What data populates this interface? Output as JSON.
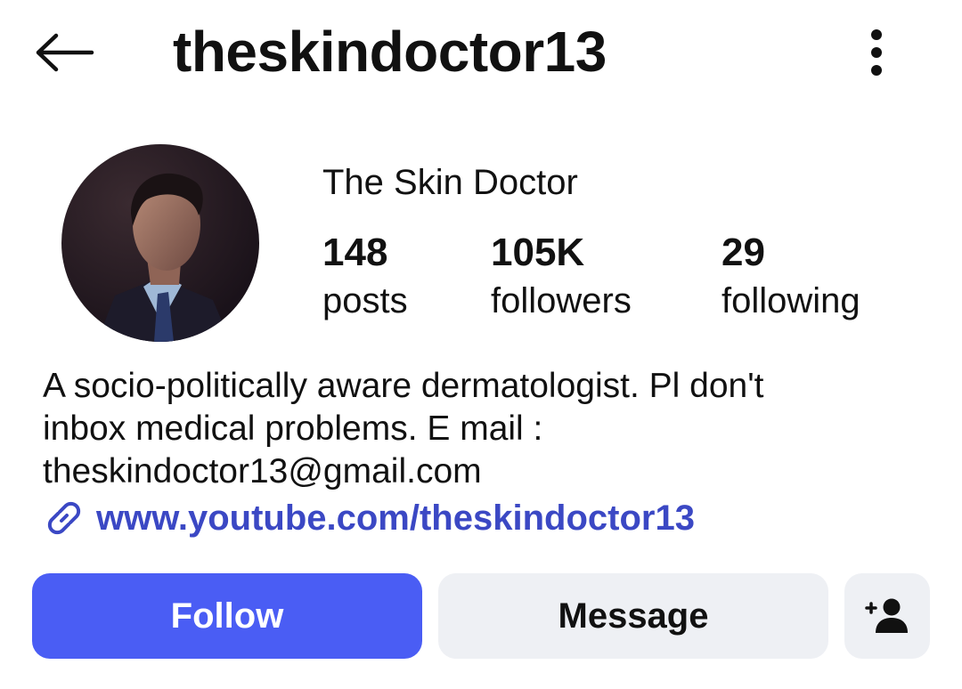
{
  "header": {
    "username": "theskindoctor13",
    "back_icon": "arrow-left-icon",
    "more_icon": "more-vertical-icon"
  },
  "profile": {
    "display_name": "The Skin Doctor",
    "avatar": "avatar",
    "stats": {
      "posts": {
        "count": "148",
        "label": "posts"
      },
      "followers": {
        "count": "105K",
        "label": "followers"
      },
      "following": {
        "count": "29",
        "label": "following"
      }
    },
    "bio_lines": [
      "A socio-politically aware dermatologist. Pl don't",
      "inbox medical problems. E mail :",
      "theskindoctor13@gmail.com"
    ],
    "link": {
      "icon": "link-icon",
      "text": "www.youtube.com/theskindoctor13"
    }
  },
  "actions": {
    "follow_label": "Follow",
    "message_label": "Message",
    "suggest_icon": "add-person-icon"
  },
  "colors": {
    "primary_button": "#4a5df4",
    "secondary_button": "#eef0f4",
    "link": "#3b48c4"
  }
}
